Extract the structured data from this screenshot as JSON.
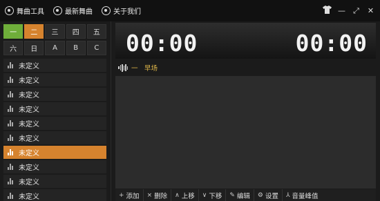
{
  "menu": {
    "items": [
      {
        "label": "舞曲工具",
        "icon": "music-tools-icon"
      },
      {
        "label": "最新舞曲",
        "icon": "new-music-icon"
      },
      {
        "label": "关于我们",
        "icon": "about-us-icon"
      }
    ]
  },
  "window_controls": {
    "skin": "T",
    "minimize": "—",
    "maximize": "⤢",
    "close": "✕"
  },
  "days": [
    "一",
    "二",
    "三",
    "四",
    "五",
    "六",
    "日",
    "A",
    "B",
    "C"
  ],
  "active_day": "二",
  "list": {
    "items": [
      "未定义",
      "未定义",
      "未定义",
      "未定义",
      "未定义",
      "未定义",
      "未定义",
      "未定义",
      "未定义",
      "未定义"
    ],
    "active_index": 6
  },
  "timers": {
    "elapsed": "00:00",
    "remaining": "00:00"
  },
  "now_playing": "一　早场",
  "toolbar": {
    "add": "添加",
    "delete": "删除",
    "up": "上移",
    "down": "下移",
    "edit": "编辑",
    "settings": "设置",
    "peak": "音量峰值"
  },
  "colors": {
    "accent_orange": "#d6832e",
    "accent_green": "#6fae3a",
    "song_title": "#e3b94a"
  }
}
